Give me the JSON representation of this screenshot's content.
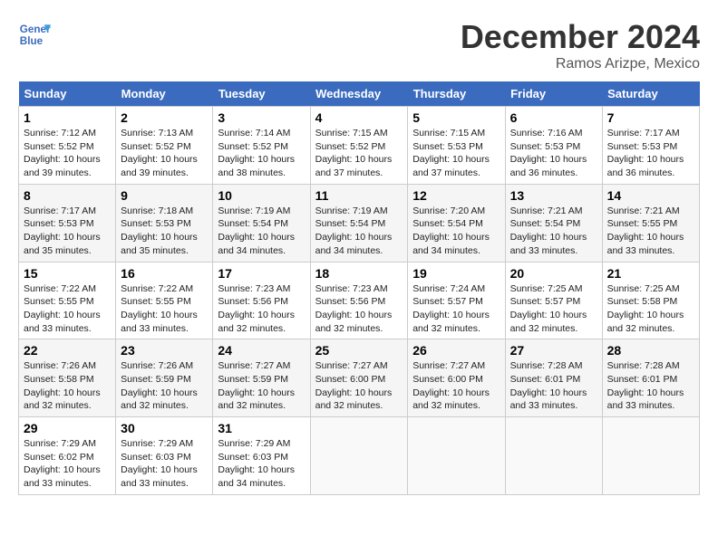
{
  "header": {
    "logo_line1": "General",
    "logo_line2": "Blue",
    "title": "December 2024",
    "location": "Ramos Arizpe, Mexico"
  },
  "days_of_week": [
    "Sunday",
    "Monday",
    "Tuesday",
    "Wednesday",
    "Thursday",
    "Friday",
    "Saturday"
  ],
  "weeks": [
    [
      {
        "day": "1",
        "info": "Sunrise: 7:12 AM\nSunset: 5:52 PM\nDaylight: 10 hours\nand 39 minutes."
      },
      {
        "day": "2",
        "info": "Sunrise: 7:13 AM\nSunset: 5:52 PM\nDaylight: 10 hours\nand 39 minutes."
      },
      {
        "day": "3",
        "info": "Sunrise: 7:14 AM\nSunset: 5:52 PM\nDaylight: 10 hours\nand 38 minutes."
      },
      {
        "day": "4",
        "info": "Sunrise: 7:15 AM\nSunset: 5:52 PM\nDaylight: 10 hours\nand 37 minutes."
      },
      {
        "day": "5",
        "info": "Sunrise: 7:15 AM\nSunset: 5:53 PM\nDaylight: 10 hours\nand 37 minutes."
      },
      {
        "day": "6",
        "info": "Sunrise: 7:16 AM\nSunset: 5:53 PM\nDaylight: 10 hours\nand 36 minutes."
      },
      {
        "day": "7",
        "info": "Sunrise: 7:17 AM\nSunset: 5:53 PM\nDaylight: 10 hours\nand 36 minutes."
      }
    ],
    [
      {
        "day": "8",
        "info": "Sunrise: 7:17 AM\nSunset: 5:53 PM\nDaylight: 10 hours\nand 35 minutes."
      },
      {
        "day": "9",
        "info": "Sunrise: 7:18 AM\nSunset: 5:53 PM\nDaylight: 10 hours\nand 35 minutes."
      },
      {
        "day": "10",
        "info": "Sunrise: 7:19 AM\nSunset: 5:54 PM\nDaylight: 10 hours\nand 34 minutes."
      },
      {
        "day": "11",
        "info": "Sunrise: 7:19 AM\nSunset: 5:54 PM\nDaylight: 10 hours\nand 34 minutes."
      },
      {
        "day": "12",
        "info": "Sunrise: 7:20 AM\nSunset: 5:54 PM\nDaylight: 10 hours\nand 34 minutes."
      },
      {
        "day": "13",
        "info": "Sunrise: 7:21 AM\nSunset: 5:54 PM\nDaylight: 10 hours\nand 33 minutes."
      },
      {
        "day": "14",
        "info": "Sunrise: 7:21 AM\nSunset: 5:55 PM\nDaylight: 10 hours\nand 33 minutes."
      }
    ],
    [
      {
        "day": "15",
        "info": "Sunrise: 7:22 AM\nSunset: 5:55 PM\nDaylight: 10 hours\nand 33 minutes."
      },
      {
        "day": "16",
        "info": "Sunrise: 7:22 AM\nSunset: 5:55 PM\nDaylight: 10 hours\nand 33 minutes."
      },
      {
        "day": "17",
        "info": "Sunrise: 7:23 AM\nSunset: 5:56 PM\nDaylight: 10 hours\nand 32 minutes."
      },
      {
        "day": "18",
        "info": "Sunrise: 7:23 AM\nSunset: 5:56 PM\nDaylight: 10 hours\nand 32 minutes."
      },
      {
        "day": "19",
        "info": "Sunrise: 7:24 AM\nSunset: 5:57 PM\nDaylight: 10 hours\nand 32 minutes."
      },
      {
        "day": "20",
        "info": "Sunrise: 7:25 AM\nSunset: 5:57 PM\nDaylight: 10 hours\nand 32 minutes."
      },
      {
        "day": "21",
        "info": "Sunrise: 7:25 AM\nSunset: 5:58 PM\nDaylight: 10 hours\nand 32 minutes."
      }
    ],
    [
      {
        "day": "22",
        "info": "Sunrise: 7:26 AM\nSunset: 5:58 PM\nDaylight: 10 hours\nand 32 minutes."
      },
      {
        "day": "23",
        "info": "Sunrise: 7:26 AM\nSunset: 5:59 PM\nDaylight: 10 hours\nand 32 minutes."
      },
      {
        "day": "24",
        "info": "Sunrise: 7:27 AM\nSunset: 5:59 PM\nDaylight: 10 hours\nand 32 minutes."
      },
      {
        "day": "25",
        "info": "Sunrise: 7:27 AM\nSunset: 6:00 PM\nDaylight: 10 hours\nand 32 minutes."
      },
      {
        "day": "26",
        "info": "Sunrise: 7:27 AM\nSunset: 6:00 PM\nDaylight: 10 hours\nand 32 minutes."
      },
      {
        "day": "27",
        "info": "Sunrise: 7:28 AM\nSunset: 6:01 PM\nDaylight: 10 hours\nand 33 minutes."
      },
      {
        "day": "28",
        "info": "Sunrise: 7:28 AM\nSunset: 6:01 PM\nDaylight: 10 hours\nand 33 minutes."
      }
    ],
    [
      {
        "day": "29",
        "info": "Sunrise: 7:29 AM\nSunset: 6:02 PM\nDaylight: 10 hours\nand 33 minutes."
      },
      {
        "day": "30",
        "info": "Sunrise: 7:29 AM\nSunset: 6:03 PM\nDaylight: 10 hours\nand 33 minutes."
      },
      {
        "day": "31",
        "info": "Sunrise: 7:29 AM\nSunset: 6:03 PM\nDaylight: 10 hours\nand 34 minutes."
      },
      {
        "day": "",
        "info": ""
      },
      {
        "day": "",
        "info": ""
      },
      {
        "day": "",
        "info": ""
      },
      {
        "day": "",
        "info": ""
      }
    ]
  ]
}
